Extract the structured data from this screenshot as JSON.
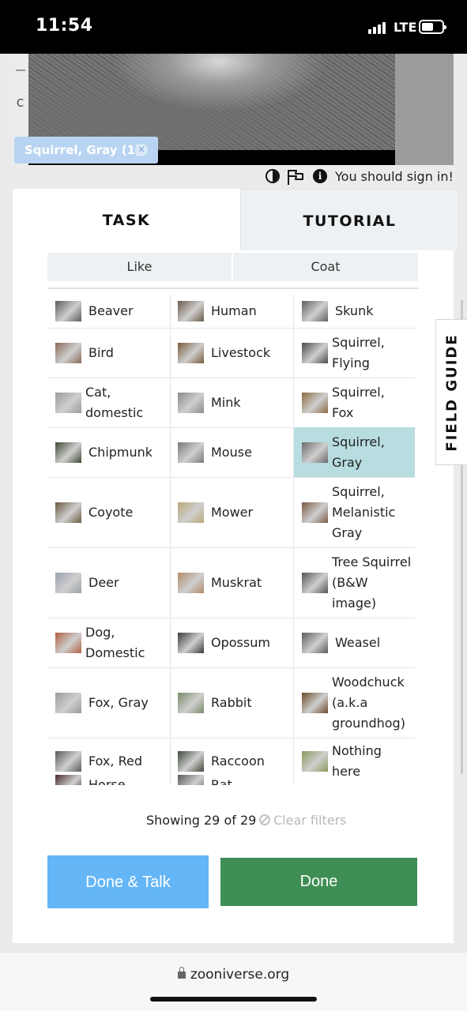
{
  "status_bar": {
    "time": "11:54",
    "network": "LTE"
  },
  "subject": {
    "side_letter": "C",
    "selected_tag": "Squirrel, Gray (1)"
  },
  "tools": {
    "sign_in_message": "You should sign in!"
  },
  "tabs": {
    "task": "TASK",
    "tutorial": "TUTORIAL"
  },
  "filters": {
    "like": "Like",
    "coat": "Coat"
  },
  "choices": [
    {
      "label": "Beaver",
      "thumb": "#5c5c5c"
    },
    {
      "label": "Human",
      "thumb": "#6b5a48"
    },
    {
      "label": "Skunk",
      "thumb": "#606060"
    },
    {
      "label": "Bird",
      "thumb": "#8a6a5a"
    },
    {
      "label": "Livestock",
      "thumb": "#7a5a3a"
    },
    {
      "label": "Squirrel,\nFlying",
      "thumb": "#4a4a4a"
    },
    {
      "label": "Cat,\ndomestic",
      "thumb": "#9a9a9a"
    },
    {
      "label": "Mink",
      "thumb": "#8a8a8a"
    },
    {
      "label": "Squirrel,\nFox",
      "thumb": "#8a6a42"
    },
    {
      "label": "Chipmunk",
      "thumb": "#3f4a30"
    },
    {
      "label": "Mouse",
      "thumb": "#7a7a7a"
    },
    {
      "label": "Squirrel,\nGray",
      "thumb": "#6a6a6a",
      "selected": true
    },
    {
      "label": "Coyote",
      "thumb": "#6a5a40"
    },
    {
      "label": "Mower",
      "thumb": "#b8a878"
    },
    {
      "label": "Squirrel,\nMelanistic\nGray",
      "thumb": "#7a5a48"
    },
    {
      "label": "Deer",
      "thumb": "#9aa0aa"
    },
    {
      "label": "Muskrat",
      "thumb": "#b08a6a"
    },
    {
      "label": "Tree Squirrel\n(B&W\nimage)",
      "thumb": "#555555"
    },
    {
      "label": "Dog,\nDomestic",
      "thumb": "#b06040"
    },
    {
      "label": "Opossum",
      "thumb": "#3a3a3a"
    },
    {
      "label": "Weasel",
      "thumb": "#5a5a5a"
    },
    {
      "label": "Fox, Gray",
      "thumb": "#9a9a9a"
    },
    {
      "label": "Rabbit",
      "thumb": "#7a8a6a"
    },
    {
      "label": "Woodchuck\n(a.k.a\ngroundhog)",
      "thumb": "#6a4a2a"
    },
    {
      "label": "Fox, Red",
      "thumb": "#5a5a5a"
    },
    {
      "label": "Raccoon",
      "thumb": "#3f4a3a"
    },
    {
      "label": "Nothing\nhere",
      "thumb": "#8a9a5a"
    },
    {
      "label": "Horse",
      "thumb": "#4a2a2a"
    },
    {
      "label": "Rat",
      "thumb": "#5a5a5a"
    }
  ],
  "results": {
    "showing": "Showing 29 of 29",
    "clear_filters": "Clear filters"
  },
  "actions": {
    "done_talk": "Done & Talk",
    "done": "Done"
  },
  "field_guide": "FIELD GUIDE",
  "browser": {
    "url": "zooniverse.org"
  },
  "colors": {
    "done_talk": "#64b6f6",
    "done": "#3f8e55",
    "selected_choice": "#b8dde0",
    "tag_chip": "#b8d4f2"
  }
}
